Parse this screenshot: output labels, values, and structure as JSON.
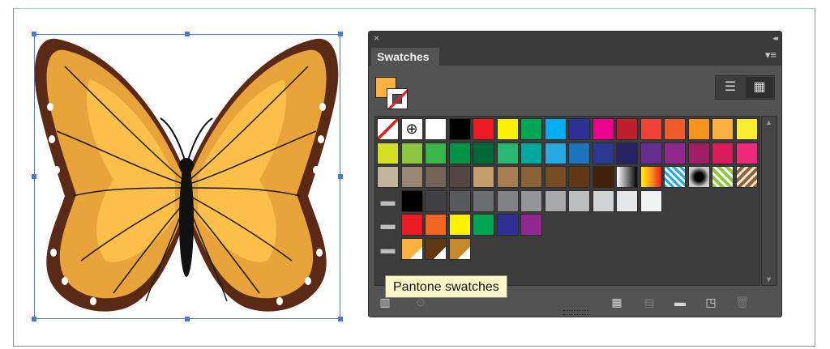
{
  "panel": {
    "close_icon": "×",
    "collapse_icon": "◂◂",
    "tab_title": "Swatches",
    "menu_icon": "▾≡",
    "view_list_icon": "☰",
    "view_grid_icon": "▦"
  },
  "tooltip": {
    "text": "Pantone swatches"
  },
  "colors": {
    "fill": "#fbb040",
    "panel_bg": "#535353",
    "selection": "#4a78d4"
  },
  "swatch_rows": [
    [
      "none",
      "registration",
      "#ffffff",
      "#000000",
      "#ed1c24",
      "#fff200",
      "#00a651",
      "#00aeef",
      "#2e3192",
      "#ec008c",
      "#be1e2d",
      "#ef4136",
      "#f15a29",
      "#f7941d",
      "#fbb040",
      "#f9ed32"
    ],
    [
      "#d7df23",
      "#8dc63f",
      "#39b54a",
      "#009444",
      "#006838",
      "#2bb673",
      "#00a79d",
      "#27aae1",
      "#1c75bc",
      "#2b3990",
      "#262262",
      "#662d91",
      "#92278f",
      "#9e1f63",
      "#da1c5c",
      "#ee2a7b"
    ],
    [
      "#c2b59b",
      "#998675",
      "#736357",
      "#534741",
      "#c69c6d",
      "#a67c52",
      "#8c6239",
      "#754c24",
      "#603813",
      "#42210b",
      "grad-bw",
      "grad-orange",
      "pattern-grid",
      "pattern-dots",
      "pattern-leaf",
      "pattern-floral"
    ],
    [
      "folder",
      "#000000",
      "#414042",
      "#58595b",
      "#6d6e71",
      "#808285",
      "#939598",
      "#a7a9ac",
      "#bcbec0",
      "#d1d3d4",
      "#e6e7e8",
      "#f1f2f2"
    ],
    [
      "folder",
      "#ed1c24",
      "#f26522",
      "#fff200",
      "#00a651",
      "#2e3192",
      "#92278f"
    ],
    [
      "folder",
      "spot-#fbb040",
      "spot-#603813",
      "spot-#c8892d"
    ]
  ],
  "bottom_icons": [
    "library-icon",
    "swatch-kind-icon",
    "swatch-options-icon",
    "new-group-icon",
    "new-swatch-icon",
    "delete-icon"
  ]
}
